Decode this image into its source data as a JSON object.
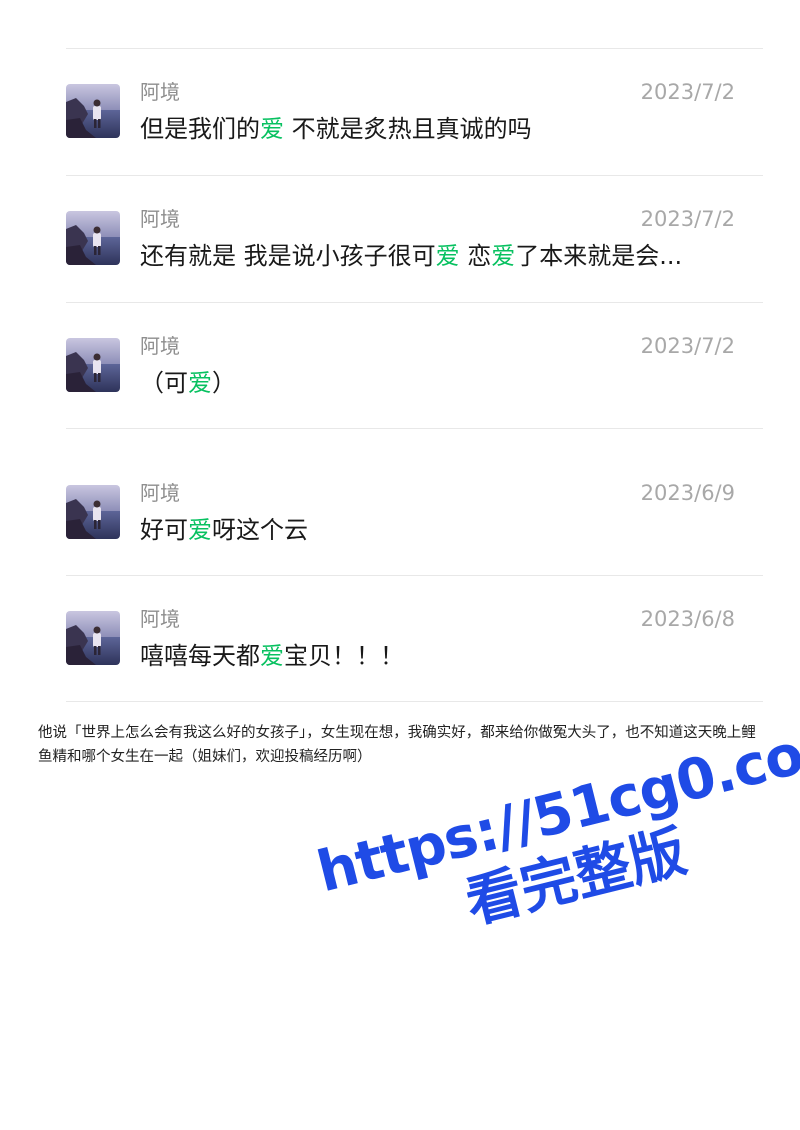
{
  "messages": [
    {
      "name": "阿境",
      "date": "2023/7/2",
      "segments": [
        {
          "text": "但是我们的",
          "hl": false
        },
        {
          "text": "爱",
          "hl": true
        },
        {
          "text": " 不就是炙热且真诚的吗",
          "hl": false
        }
      ]
    },
    {
      "name": "阿境",
      "date": "2023/7/2",
      "segments": [
        {
          "text": "还有就是 我是说小孩子很可",
          "hl": false
        },
        {
          "text": "爱",
          "hl": true
        },
        {
          "text": " 恋",
          "hl": false
        },
        {
          "text": "爱",
          "hl": true
        },
        {
          "text": "了本来就是会...",
          "hl": false
        }
      ]
    },
    {
      "name": "阿境",
      "date": "2023/7/2",
      "segments": [
        {
          "text": "（可",
          "hl": false
        },
        {
          "text": "爱",
          "hl": true
        },
        {
          "text": "）",
          "hl": false
        }
      ]
    },
    {
      "name": "阿境",
      "date": "2023/6/9",
      "segments": [
        {
          "text": "好可",
          "hl": false
        },
        {
          "text": "爱",
          "hl": true
        },
        {
          "text": "呀这个云",
          "hl": false
        }
      ]
    },
    {
      "name": "阿境",
      "date": "2023/6/8",
      "segments": [
        {
          "text": "嘻嘻每天都",
          "hl": false
        },
        {
          "text": "爱",
          "hl": true
        },
        {
          "text": "宝贝！！！",
          "hl": false
        }
      ]
    }
  ],
  "caption": "他说「世界上怎么会有我这么好的女孩子」，女生现在想，我确实好，都来给你做冤大头了，也不知道这天晚上鲤鱼精和哪个女生在一起（姐妹们，欢迎投稿经历啊）",
  "watermark": {
    "url": "https://51cg0.co",
    "text": "看完整版"
  },
  "colors": {
    "highlight": "#07c160",
    "meta": "#a8a8a8",
    "watermark": "#1f4be6"
  }
}
